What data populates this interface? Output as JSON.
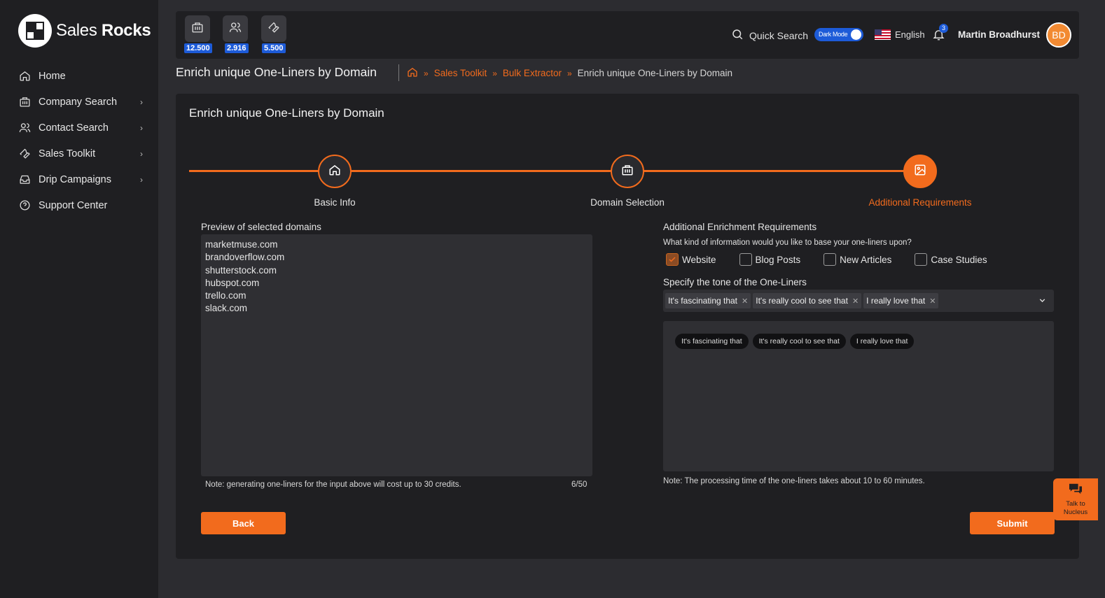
{
  "brand": {
    "name_regular": "Sales ",
    "name_bold": "Rocks"
  },
  "sidebar": {
    "items": [
      {
        "label": "Home",
        "icon": "home-icon"
      },
      {
        "label": "Company Search",
        "icon": "building-icon",
        "has_submenu": true
      },
      {
        "label": "Contact Search",
        "icon": "users-icon",
        "has_submenu": true
      },
      {
        "label": "Sales Toolkit",
        "icon": "wrench-icon",
        "has_submenu": true
      },
      {
        "label": "Drip Campaigns",
        "icon": "inbox-icon",
        "has_submenu": true
      },
      {
        "label": "Support Center",
        "icon": "help-circle-icon"
      }
    ]
  },
  "topbar": {
    "credits": [
      {
        "icon": "building-icon",
        "value": "12.500"
      },
      {
        "icon": "users-icon",
        "value": "2.916"
      },
      {
        "icon": "wrench-icon",
        "value": "5.500"
      }
    ],
    "quick_search": "Quick Search",
    "dark_mode_label": "Dark Mode",
    "dark_mode_on": true,
    "language": "English",
    "notification_count": "3",
    "user_name": "Martin Broadhurst",
    "user_initials": "BD"
  },
  "header": {
    "title": "Enrich unique One-Liners by Domain",
    "breadcrumb": [
      "Sales Toolkit",
      "Bulk Extractor",
      "Enrich unique One-Liners by Domain"
    ]
  },
  "card": {
    "title": "Enrich unique One-Liners by Domain",
    "steps": [
      {
        "label": "Basic Info",
        "icon": "home-icon",
        "active": false
      },
      {
        "label": "Domain Selection",
        "icon": "building-icon",
        "active": false
      },
      {
        "label": "Additional Requirements",
        "icon": "image-icon",
        "active": true
      }
    ],
    "preview": {
      "label": "Preview of selected domains",
      "domains": [
        "marketmuse.com",
        "brandoverflow.com",
        "shutterstock.com",
        "hubspot.com",
        "trello.com",
        "slack.com"
      ],
      "note": "Note: generating one-liners for the input above will cost up to 30 credits.",
      "counter": "6/50"
    },
    "requirements": {
      "label": "Additional Enrichment Requirements",
      "question": "What kind of information would you like to base your one-liners upon?",
      "options": [
        {
          "label": "Website",
          "checked": true
        },
        {
          "label": "Blog Posts",
          "checked": false
        },
        {
          "label": "New Articles",
          "checked": false
        },
        {
          "label": "Case Studies",
          "checked": false
        }
      ],
      "tone_label": "Specify the tone of the One-Liners",
      "tones": [
        "It's fascinating that",
        "It's really cool to see that",
        "I really love that"
      ],
      "note": "Note: The processing time of the one-liners takes about 10 to 60 minutes."
    },
    "back_label": "Back",
    "submit_label": "Submit"
  },
  "chat_widget": {
    "line1": "Talk to",
    "line2": "Nucleus"
  },
  "colors": {
    "accent": "#f26b1d",
    "badge_blue": "#1d5bd8",
    "sidebar_bg": "#1f1f22",
    "page_bg": "#2c2c30"
  }
}
